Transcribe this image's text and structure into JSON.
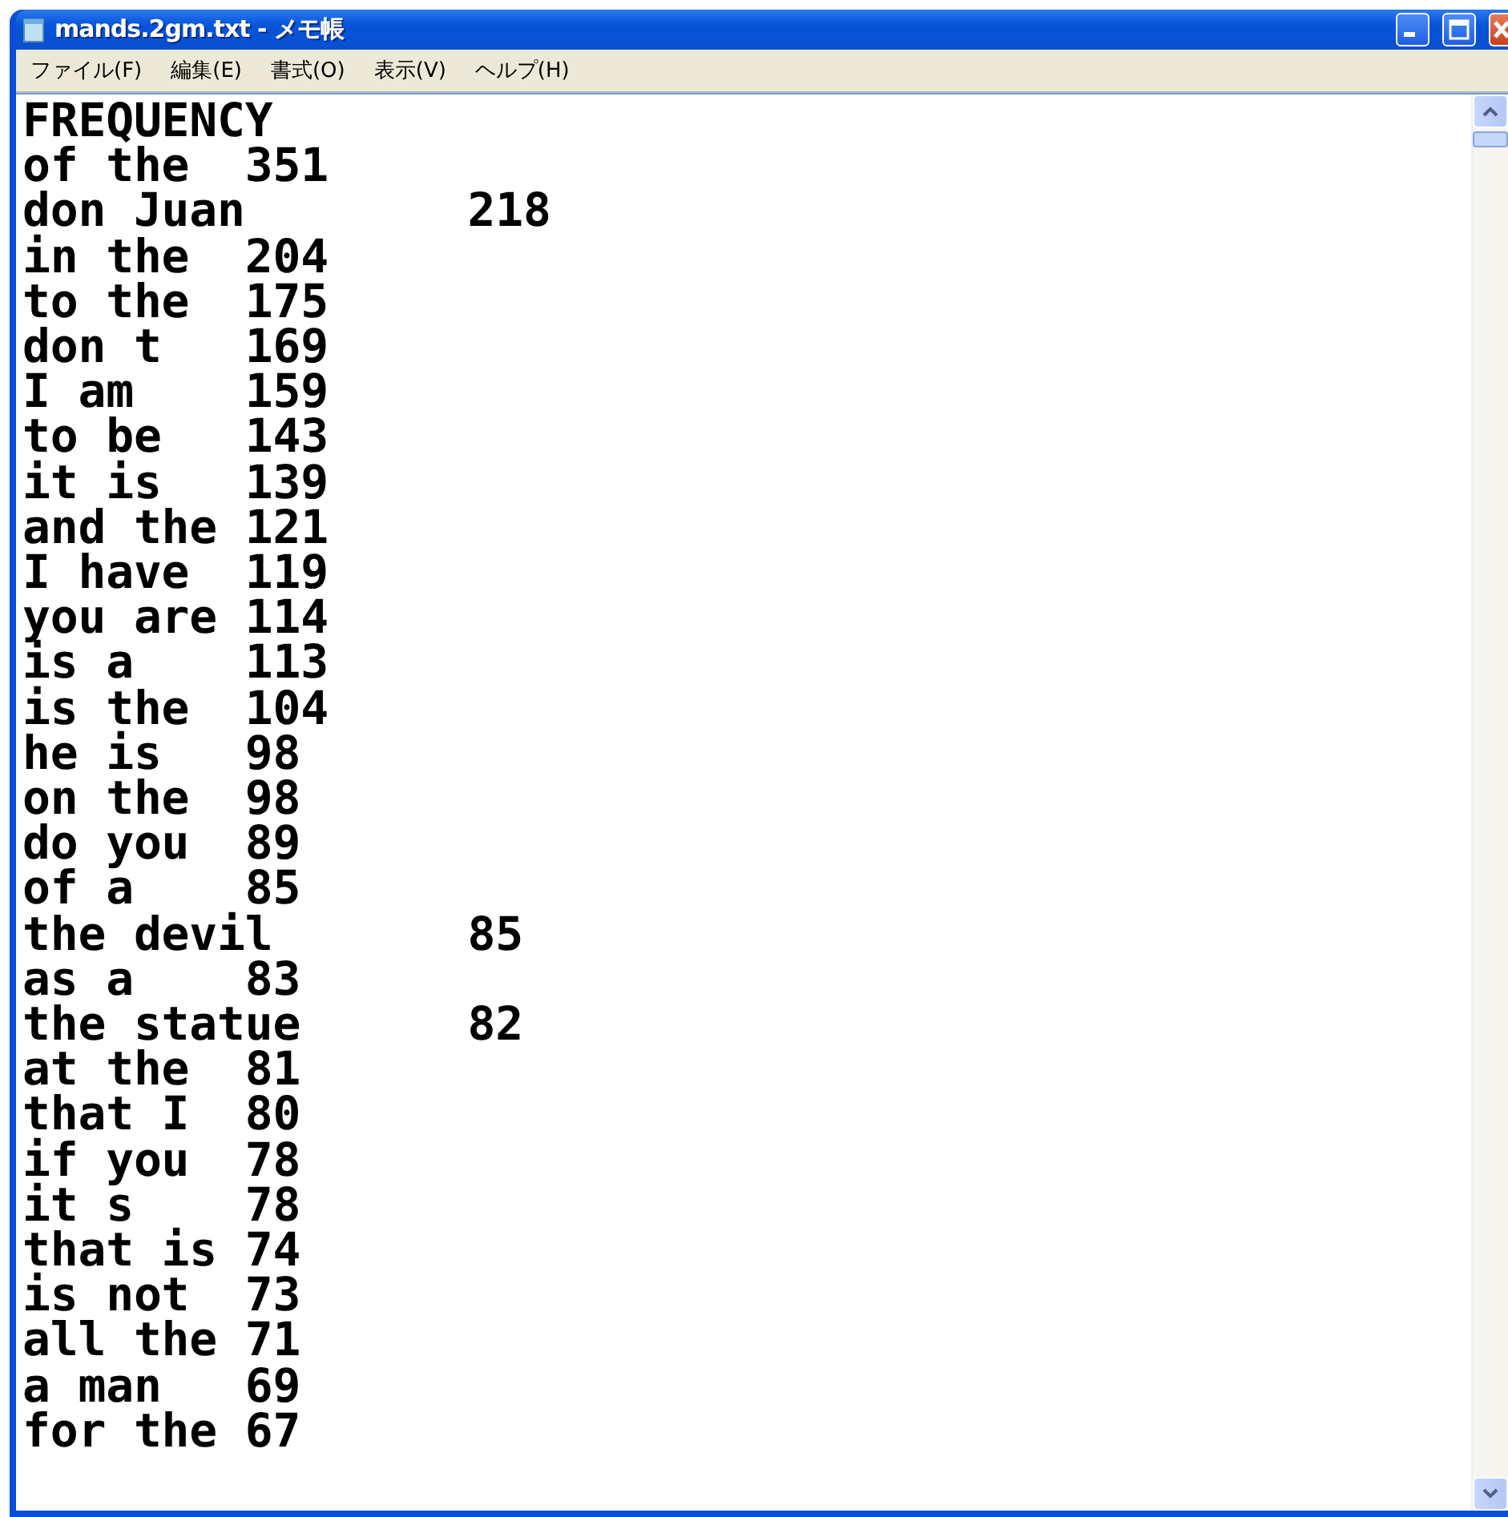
{
  "window": {
    "title": "mands.2gm.txt - メモ帳"
  },
  "menu": [
    "ファイル(F)",
    "編集(E)",
    "書式(O)",
    "表示(V)",
    "ヘルプ(H)"
  ],
  "lines": [
    "FREQUENCY",
    "of the\t351",
    "don Juan\t218",
    "in the\t204",
    "to the\t175",
    "don t\t169",
    "I am\t159",
    "to be\t143",
    "it is\t139",
    "and the\t121",
    "I have\t119",
    "you are\t114",
    "is a\t113",
    "is the\t104",
    "he is\t98",
    "on the\t98",
    "do you\t89",
    "of a\t85",
    "the devil\t85",
    "as a\t83",
    "the statue\t82",
    "at the\t81",
    "that I\t80",
    "if you\t78",
    "it s\t78",
    "that is\t74",
    "is not\t73",
    "all the\t71",
    "a man\t69",
    "for the\t67"
  ]
}
